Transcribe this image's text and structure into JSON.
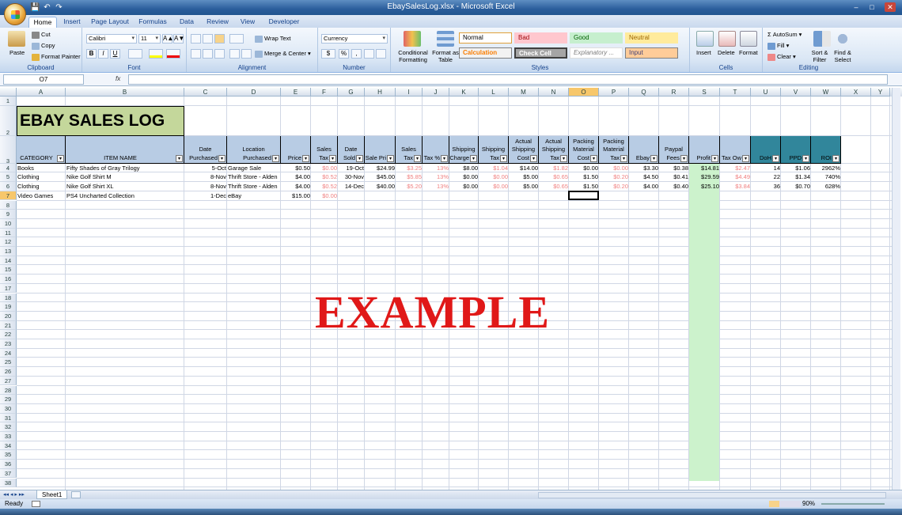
{
  "window": {
    "title": "EbaySalesLog.xlsx - Microsoft Excel",
    "minimize": "–",
    "maximize": "□",
    "close": "✕"
  },
  "qat": {
    "save": "💾",
    "undo": "↶",
    "redo": "↷"
  },
  "tabs": [
    "Home",
    "Insert",
    "Page Layout",
    "Formulas",
    "Data",
    "Review",
    "View",
    "Developer"
  ],
  "ribbon": {
    "clipboard": {
      "label": "Clipboard",
      "paste": "Paste",
      "cut": "Cut",
      "copy": "Copy",
      "format_painter": "Format Painter"
    },
    "font": {
      "label": "Font",
      "name": "Calibri",
      "size": "11",
      "bold": "B",
      "italic": "I",
      "underline": "U",
      "grow": "A▲",
      "shrink": "A▼"
    },
    "alignment": {
      "label": "Alignment",
      "wrap": "Wrap Text",
      "merge": "Merge & Center"
    },
    "number": {
      "label": "Number",
      "format": "Currency",
      "dollar": "$",
      "percent": "%",
      "comma": ","
    },
    "styles": {
      "label": "Styles",
      "conditional": "Conditional Formatting",
      "format_table": "Format as Table",
      "normal": "Normal",
      "bad": "Bad",
      "good": "Good",
      "neutral": "Neutral",
      "calculation": "Calculation",
      "check_cell": "Check Cell",
      "explanatory": "Explanatory ...",
      "input": "Input"
    },
    "cells": {
      "label": "Cells",
      "insert": "Insert",
      "delete": "Delete",
      "format": "Format"
    },
    "editing": {
      "label": "Editing",
      "autosum": "AutoSum",
      "fill": "Fill",
      "clear": "Clear",
      "sort": "Sort & Filter",
      "find": "Find & Select"
    }
  },
  "formula_bar": {
    "name_box": "O7",
    "fx": "fx",
    "value": ""
  },
  "columns": [
    "A",
    "B",
    "C",
    "D",
    "E",
    "F",
    "G",
    "H",
    "I",
    "J",
    "K",
    "L",
    "M",
    "N",
    "O",
    "P",
    "Q",
    "R",
    "S",
    "T",
    "U",
    "V",
    "W",
    "X",
    "Y"
  ],
  "selected_column": "O",
  "rows": [
    "1",
    "2",
    "3",
    "4",
    "5",
    "6",
    "7",
    "8",
    "9",
    "10",
    "11",
    "12",
    "13",
    "14",
    "15",
    "16",
    "17",
    "18",
    "19",
    "20",
    "21",
    "22",
    "23",
    "24",
    "25",
    "26",
    "27",
    "28",
    "29",
    "30",
    "31",
    "32",
    "33",
    "34",
    "35",
    "36",
    "37",
    "38"
  ],
  "selected_row": "7",
  "sheet_title": "EBAY SALES LOG",
  "headers": [
    {
      "l1": "",
      "l2": "CATEGORY"
    },
    {
      "l1": "",
      "l2": "ITEM NAME"
    },
    {
      "l1": "Date",
      "l2": "Purchased"
    },
    {
      "l1": "Location",
      "l2": "Purchased"
    },
    {
      "l1": "",
      "l2": "Price"
    },
    {
      "l1": "Sales",
      "l2": "Tax"
    },
    {
      "l1": "Date",
      "l2": "Sold"
    },
    {
      "l1": "",
      "l2": "Sale Pri"
    },
    {
      "l1": "Sales",
      "l2": "Tax"
    },
    {
      "l1": "",
      "l2": "Tax %"
    },
    {
      "l1": "Shipping",
      "l2": "Charge"
    },
    {
      "l1": "Shipping",
      "l2": "Tax"
    },
    {
      "l1": "Actual Shipping",
      "l2": "Cost"
    },
    {
      "l1": "Actual Shipping",
      "l2": "Tax"
    },
    {
      "l1": "Packing Material",
      "l2": "Cost"
    },
    {
      "l1": "Packing Material",
      "l2": "Tax"
    },
    {
      "l1": "",
      "l2": "Ebay Fe"
    },
    {
      "l1": "Paypal",
      "l2": "Fees"
    },
    {
      "l1": "",
      "l2": "Profit"
    },
    {
      "l1": "",
      "l2": "Tax Ow"
    },
    {
      "l1": "",
      "l2": "DoH"
    },
    {
      "l1": "",
      "l2": "PPD"
    },
    {
      "l1": "",
      "l2": "ROI"
    }
  ],
  "data_rows": [
    [
      "Books",
      "Fifty Shades of Gray Trilogy",
      "5-Oct",
      "Garage Sale",
      "$0.50",
      "$0.00",
      "19-Oct",
      "$24.99",
      "$3.25",
      "13%",
      "$8.00",
      "$1.04",
      "$14.00",
      "$1.82",
      "$0.00",
      "$0.00",
      "$3.30",
      "$0.38",
      "$14.81",
      "$2.47",
      "14",
      "$1.06",
      "2962%"
    ],
    [
      "Clothing",
      "Nike Golf Shirt M",
      "8-Nov",
      "Thrift Store - Alden",
      "$4.00",
      "$0.52",
      "30-Nov",
      "$45.00",
      "$5.85",
      "13%",
      "$0.00",
      "$0.00",
      "$5.00",
      "$0.65",
      "$1.50",
      "$0.20",
      "$4.50",
      "$0.41",
      "$29.59",
      "$4.49",
      "22",
      "$1.34",
      "740%"
    ],
    [
      "Clothing",
      "Nike Golf Shirt XL",
      "8-Nov",
      "Thrift Store - Alden",
      "$4.00",
      "$0.52",
      "14-Dec",
      "$40.00",
      "$5.20",
      "13%",
      "$0.00",
      "$0.00",
      "$5.00",
      "$0.65",
      "$1.50",
      "$0.20",
      "$4.00",
      "$0.40",
      "$25.10",
      "$3.84",
      "36",
      "$0.70",
      "628%"
    ],
    [
      "Video Games",
      "PS4 Uncharted Collection",
      "1-Dec",
      "eBay",
      "$15.00",
      "$0.00",
      "",
      "",
      "",
      "",
      "",
      "",
      "",
      "",
      "",
      "",
      "",
      "",
      "",
      "",
      "",
      "",
      ""
    ]
  ],
  "watermark": "EXAMPLE",
  "sheet_tab": "Sheet1",
  "status": {
    "ready": "Ready",
    "zoom": "90%"
  },
  "colors": {
    "header_fill": "#b8cce4",
    "teal_fill": "#31869b",
    "profit_fill": "#ccf2cc",
    "title_fill": "#c4d79b",
    "watermark": "#e01818"
  }
}
